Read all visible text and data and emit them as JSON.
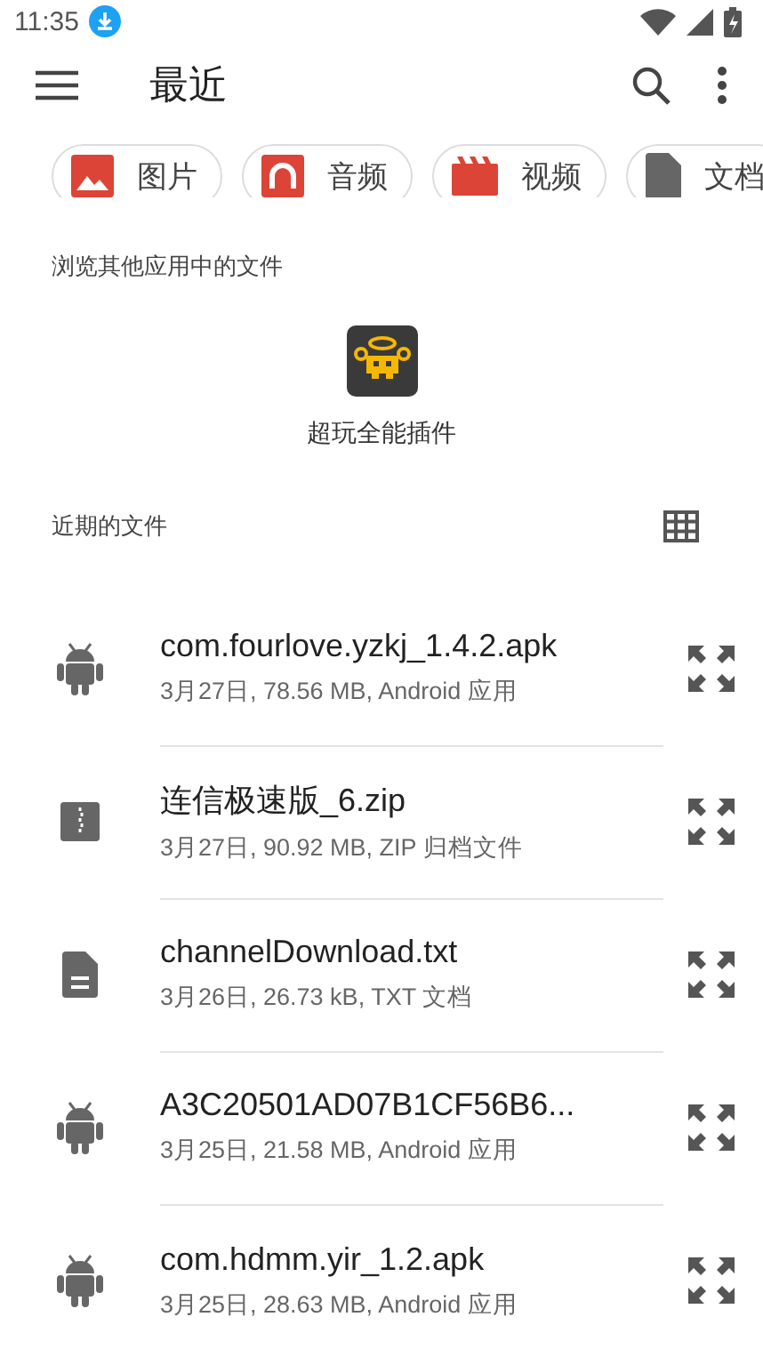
{
  "status_bar": {
    "time": "11:35"
  },
  "toolbar": {
    "title": "最近"
  },
  "chips": [
    {
      "kind": "image",
      "label": "图片"
    },
    {
      "kind": "audio",
      "label": "音频"
    },
    {
      "kind": "video",
      "label": "视频"
    },
    {
      "kind": "doc",
      "label": "文档"
    }
  ],
  "apps_section": {
    "heading": "浏览其他应用中的文件",
    "apps": [
      {
        "label": "超玩全能插件"
      }
    ]
  },
  "recent_section": {
    "heading": "近期的文件"
  },
  "files": [
    {
      "kind": "apk",
      "name": "com.fourlove.yzkj_1.4.2.apk",
      "details": "3月27日, 78.56 MB, Android 应用"
    },
    {
      "kind": "zip",
      "name": "连信极速版_6.zip",
      "details": "3月27日, 90.92 MB, ZIP 归档文件"
    },
    {
      "kind": "txt",
      "name": "channelDownload.txt",
      "details": "3月26日, 26.73 kB, TXT 文档"
    },
    {
      "kind": "apk",
      "name": "A3C20501AD07B1CF56B6...",
      "details": "3月25日, 21.58 MB, Android 应用"
    },
    {
      "kind": "apk",
      "name": "com.hdmm.yir_1.2.apk",
      "details": "3月25日, 28.63 MB, Android 应用"
    }
  ]
}
